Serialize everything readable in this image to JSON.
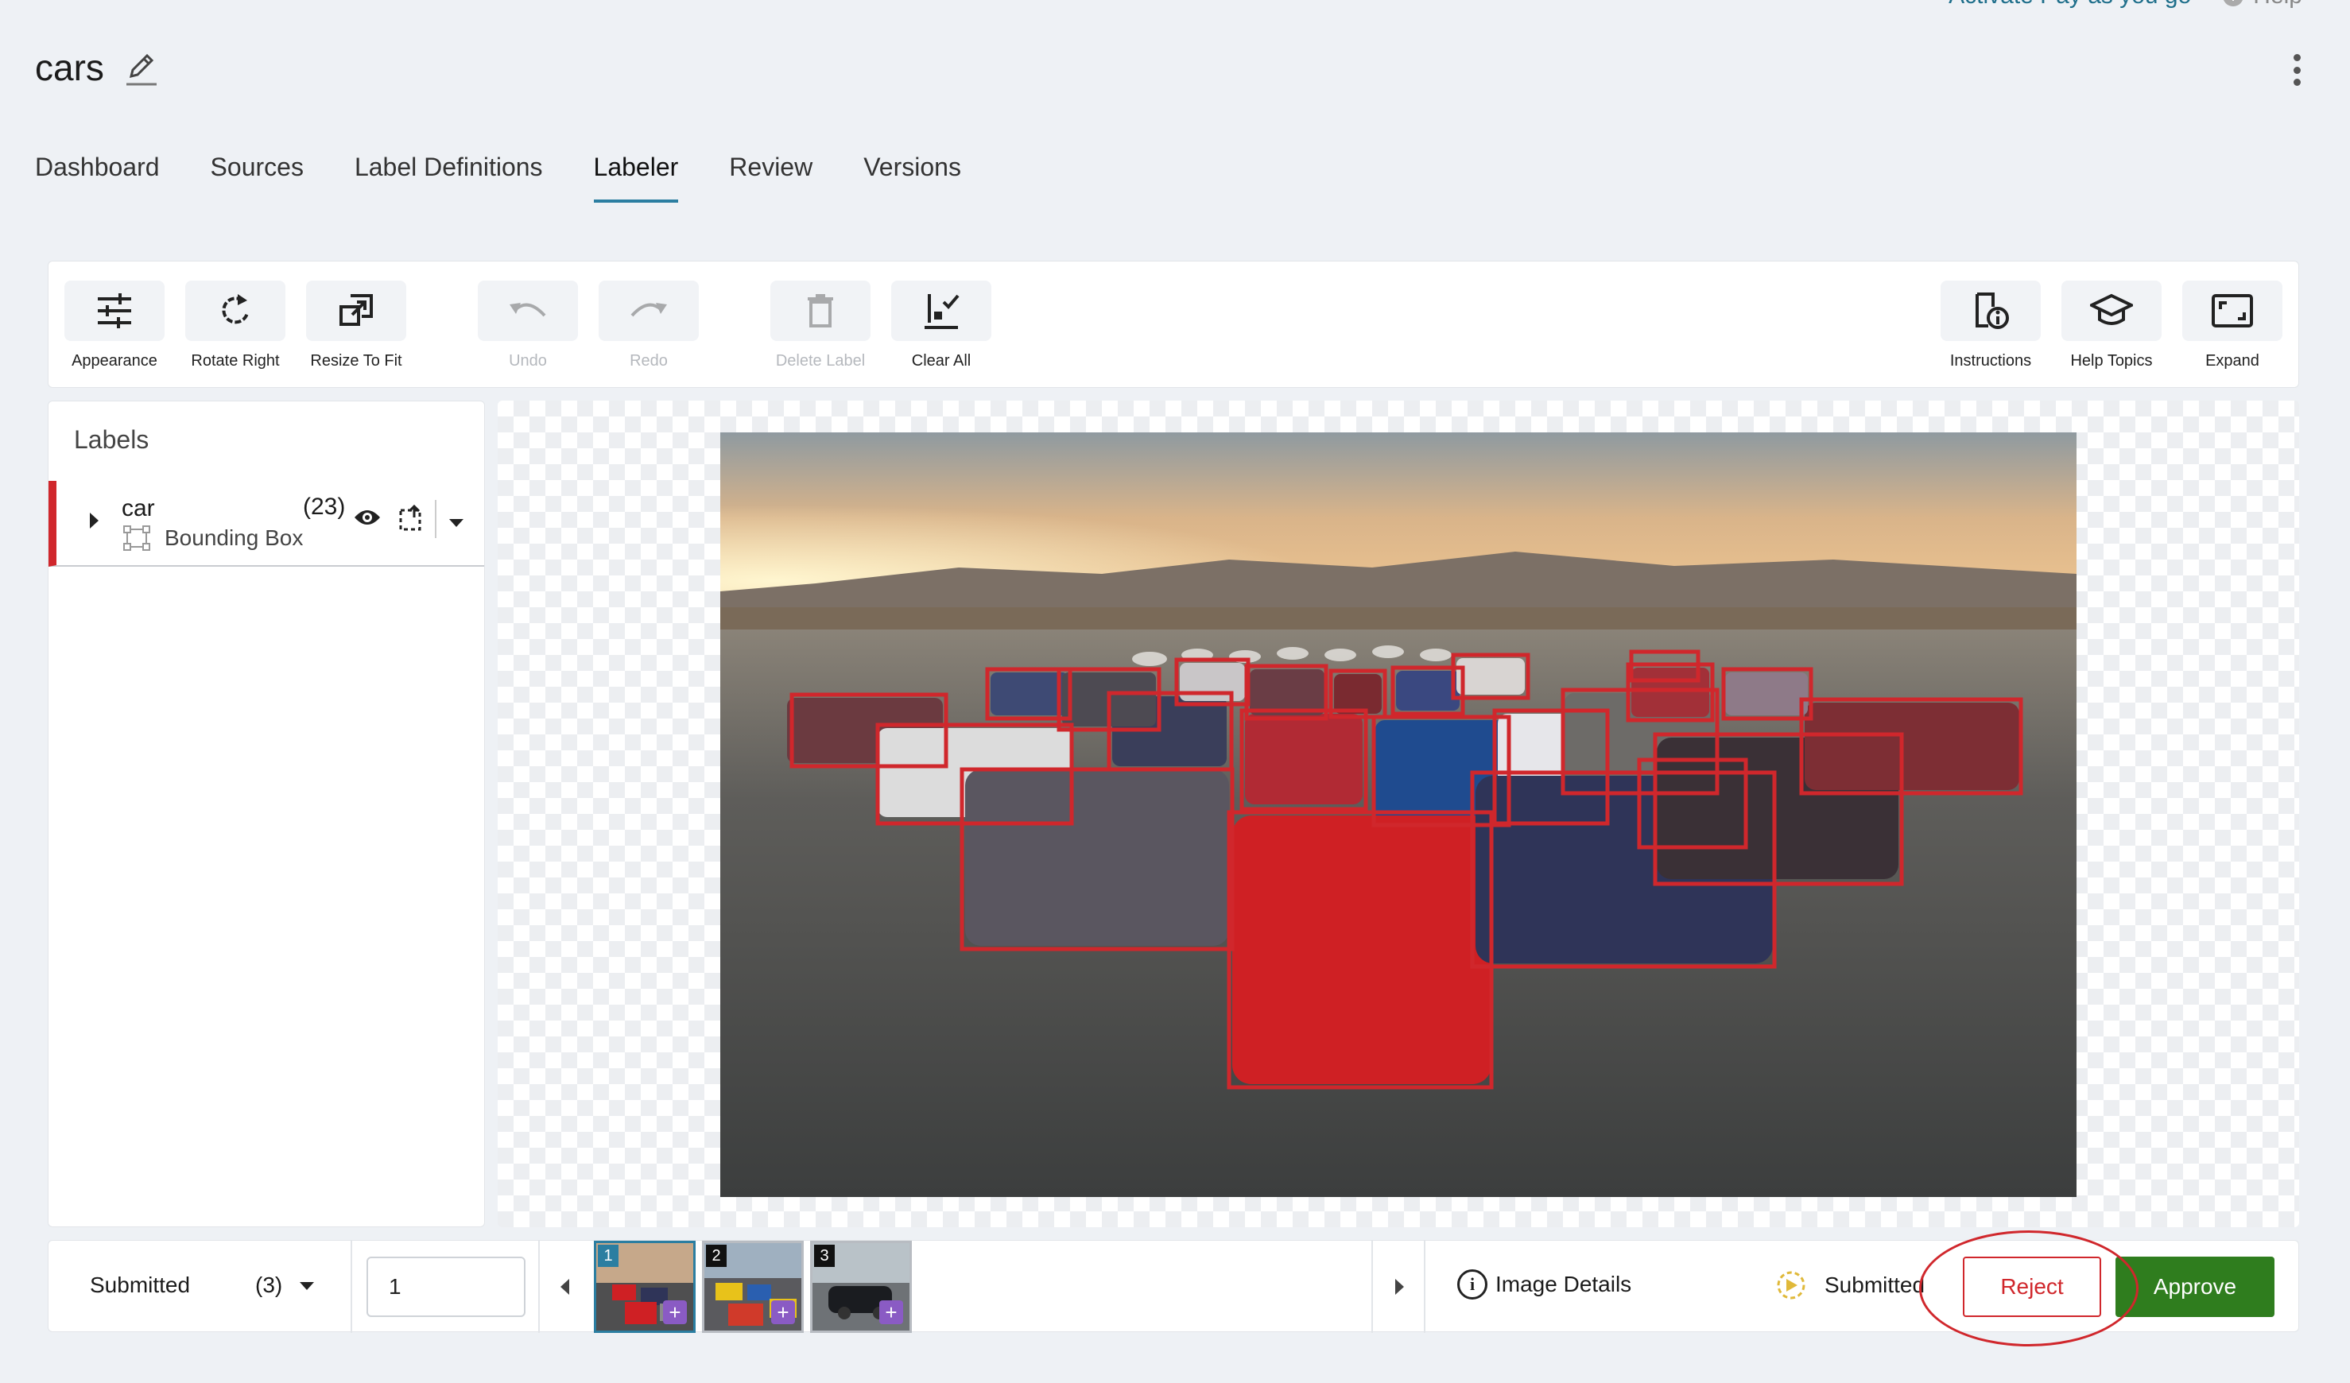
{
  "topbar": {
    "pay_link": "Activate Pay as you go",
    "help": "Help"
  },
  "project": {
    "title": "cars"
  },
  "tabs": [
    {
      "label": "Dashboard"
    },
    {
      "label": "Sources"
    },
    {
      "label": "Label Definitions"
    },
    {
      "label": "Labeler",
      "active": true
    },
    {
      "label": "Review"
    },
    {
      "label": "Versions"
    }
  ],
  "toolbar": {
    "appearance": "Appearance",
    "rotate_right": "Rotate Right",
    "resize_to_fit": "Resize To Fit",
    "undo": "Undo",
    "redo": "Redo",
    "delete_label": "Delete Label",
    "clear_all": "Clear All",
    "instructions": "Instructions",
    "help_topics": "Help Topics",
    "expand": "Expand"
  },
  "labels_panel": {
    "heading": "Labels",
    "items": [
      {
        "name": "car",
        "count": "(23)",
        "type": "Bounding Box",
        "color": "#d0272c"
      }
    ]
  },
  "bottom_bar": {
    "status": "Submitted",
    "status_count": "(3)",
    "page_input": "1",
    "thumbnails": [
      {
        "num": "1",
        "selected": true
      },
      {
        "num": "2"
      },
      {
        "num": "3"
      }
    ],
    "image_details": "Image Details",
    "submitted_status": "Submitted",
    "reject": "Reject",
    "approve": "Approve"
  },
  "colors": {
    "accent": "#2b7ea1",
    "reject": "#d0272c",
    "approve": "#2f7d1e",
    "box": "#d0272c"
  }
}
